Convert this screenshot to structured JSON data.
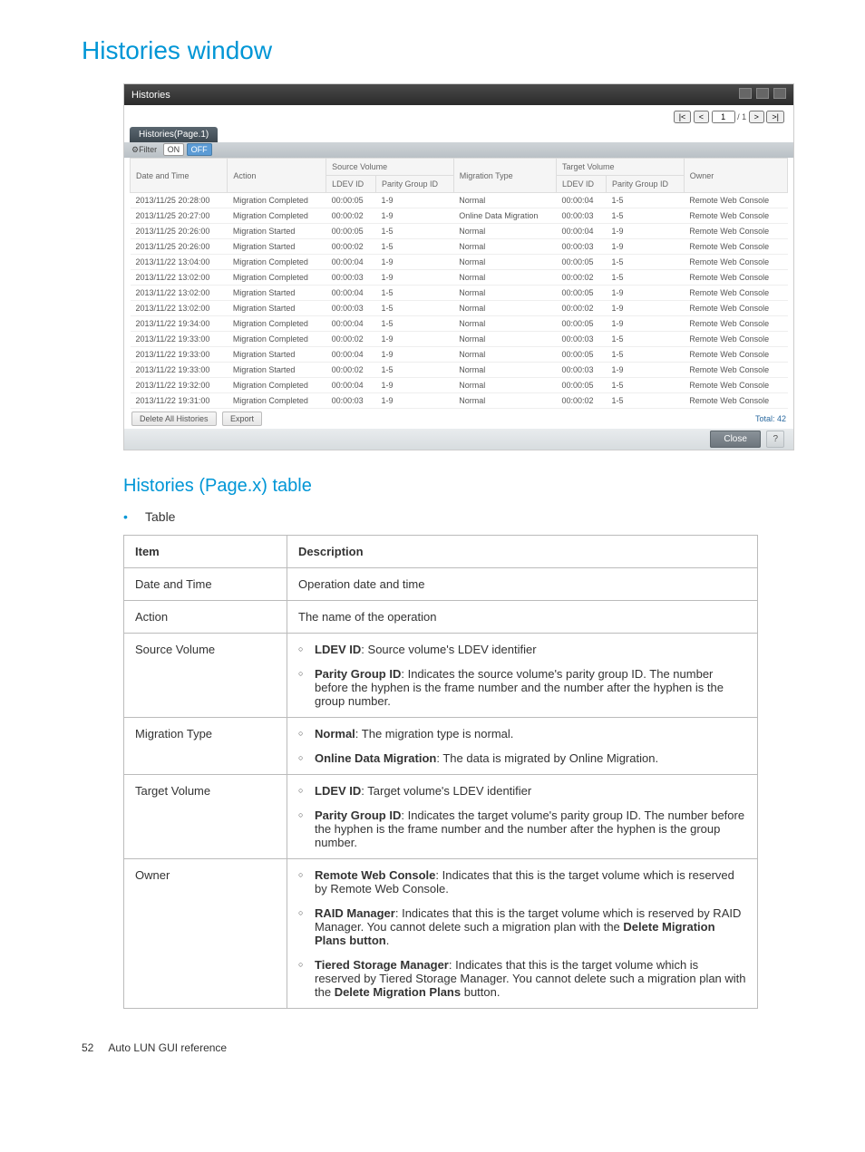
{
  "page": {
    "title": "Histories window",
    "subhead": "Histories (Page.x) table",
    "bullet_label": "Table",
    "footer_page_num": "52",
    "footer_text": "Auto LUN GUI reference"
  },
  "screenshot": {
    "window_title": "Histories",
    "pager": {
      "current": "1",
      "total": "/ 1"
    },
    "tab_label": "Histories(Page.1)",
    "filter_label": "⚙Filter",
    "on_label": "ON",
    "off_label": "OFF",
    "headers": {
      "date_time": "Date and Time",
      "action": "Action",
      "source_volume": "Source Volume",
      "ldev_id": "LDEV ID",
      "parity_group_id": "Parity Group ID",
      "migration_type": "Migration Type",
      "target_volume": "Target Volume",
      "owner": "Owner"
    },
    "rows": [
      {
        "dt": "2013/11/25 20:28:00",
        "action": "Migration Completed",
        "sldev": "00:00:05",
        "spg": "1-9",
        "mtype": "Normal",
        "tldev": "00:00:04",
        "tpg": "1-5",
        "owner": "Remote Web Console"
      },
      {
        "dt": "2013/11/25 20:27:00",
        "action": "Migration Completed",
        "sldev": "00:00:02",
        "spg": "1-9",
        "mtype": "Online Data Migration",
        "tldev": "00:00:03",
        "tpg": "1-5",
        "owner": "Remote Web Console"
      },
      {
        "dt": "2013/11/25 20:26:00",
        "action": "Migration Started",
        "sldev": "00:00:05",
        "spg": "1-5",
        "mtype": "Normal",
        "tldev": "00:00:04",
        "tpg": "1-9",
        "owner": "Remote Web Console"
      },
      {
        "dt": "2013/11/25 20:26:00",
        "action": "Migration Started",
        "sldev": "00:00:02",
        "spg": "1-5",
        "mtype": "Normal",
        "tldev": "00:00:03",
        "tpg": "1-9",
        "owner": "Remote Web Console"
      },
      {
        "dt": "2013/11/22 13:04:00",
        "action": "Migration Completed",
        "sldev": "00:00:04",
        "spg": "1-9",
        "mtype": "Normal",
        "tldev": "00:00:05",
        "tpg": "1-5",
        "owner": "Remote Web Console"
      },
      {
        "dt": "2013/11/22 13:02:00",
        "action": "Migration Completed",
        "sldev": "00:00:03",
        "spg": "1-9",
        "mtype": "Normal",
        "tldev": "00:00:02",
        "tpg": "1-5",
        "owner": "Remote Web Console"
      },
      {
        "dt": "2013/11/22 13:02:00",
        "action": "Migration Started",
        "sldev": "00:00:04",
        "spg": "1-5",
        "mtype": "Normal",
        "tldev": "00:00:05",
        "tpg": "1-9",
        "owner": "Remote Web Console"
      },
      {
        "dt": "2013/11/22 13:02:00",
        "action": "Migration Started",
        "sldev": "00:00:03",
        "spg": "1-5",
        "mtype": "Normal",
        "tldev": "00:00:02",
        "tpg": "1-9",
        "owner": "Remote Web Console"
      },
      {
        "dt": "2013/11/22 19:34:00",
        "action": "Migration Completed",
        "sldev": "00:00:04",
        "spg": "1-5",
        "mtype": "Normal",
        "tldev": "00:00:05",
        "tpg": "1-9",
        "owner": "Remote Web Console"
      },
      {
        "dt": "2013/11/22 19:33:00",
        "action": "Migration Completed",
        "sldev": "00:00:02",
        "spg": "1-9",
        "mtype": "Normal",
        "tldev": "00:00:03",
        "tpg": "1-5",
        "owner": "Remote Web Console"
      },
      {
        "dt": "2013/11/22 19:33:00",
        "action": "Migration Started",
        "sldev": "00:00:04",
        "spg": "1-9",
        "mtype": "Normal",
        "tldev": "00:00:05",
        "tpg": "1-5",
        "owner": "Remote Web Console"
      },
      {
        "dt": "2013/11/22 19:33:00",
        "action": "Migration Started",
        "sldev": "00:00:02",
        "spg": "1-5",
        "mtype": "Normal",
        "tldev": "00:00:03",
        "tpg": "1-9",
        "owner": "Remote Web Console"
      },
      {
        "dt": "2013/11/22 19:32:00",
        "action": "Migration Completed",
        "sldev": "00:00:04",
        "spg": "1-9",
        "mtype": "Normal",
        "tldev": "00:00:05",
        "tpg": "1-5",
        "owner": "Remote Web Console"
      },
      {
        "dt": "2013/11/22 19:31:00",
        "action": "Migration Completed",
        "sldev": "00:00:03",
        "spg": "1-9",
        "mtype": "Normal",
        "tldev": "00:00:02",
        "tpg": "1-5",
        "owner": "Remote Web Console"
      }
    ],
    "buttons": {
      "delete_all": "Delete All Histories",
      "export": "Export",
      "total_label": "Total:",
      "total_value": "42",
      "close": "Close",
      "help": "?"
    }
  },
  "desc_table": {
    "header_item": "Item",
    "header_desc": "Description",
    "rows": {
      "date_time": {
        "item": "Date and Time",
        "desc": "Operation date and time"
      },
      "action": {
        "item": "Action",
        "desc": "The name of the operation"
      },
      "source_volume": {
        "item": "Source Volume",
        "b1_strong": "LDEV ID",
        "b1_rest": ": Source volume's LDEV identifier",
        "b2_strong": "Parity Group ID",
        "b2_rest": ": Indicates the source volume's parity group ID. The number before the hyphen is the frame number and the number after the hyphen is the group number."
      },
      "migration_type": {
        "item": "Migration Type",
        "b1_strong": "Normal",
        "b1_rest": ": The migration type is normal.",
        "b2_strong": "Online Data Migration",
        "b2_rest": ": The data is migrated by Online Migration."
      },
      "target_volume": {
        "item": "Target Volume",
        "b1_strong": "LDEV ID",
        "b1_rest": ": Target volume's LDEV identifier",
        "b2_strong": "Parity Group ID",
        "b2_rest": ": Indicates the target volume's parity group ID. The number before the hyphen is the frame number and the number after the hyphen is the group number."
      },
      "owner": {
        "item": "Owner",
        "b1_strong": "Remote Web Console",
        "b1_rest": ": Indicates that this is the target volume which is reserved by Remote Web Console.",
        "b2_strong": "RAID Manager",
        "b2_rest_a": ": Indicates that this is the target volume which is reserved by RAID Manager. You cannot delete such a migration plan with the ",
        "b2_rest_b_strong": "Delete Migration Plans button",
        "b2_rest_c": ".",
        "b3_strong": "Tiered Storage Manager",
        "b3_rest_a": ": Indicates that this is the target volume which is reserved by Tiered Storage Manager. You cannot delete such a migration plan with the ",
        "b3_rest_b_strong": "Delete Migration Plans",
        "b3_rest_c": " button."
      }
    }
  }
}
